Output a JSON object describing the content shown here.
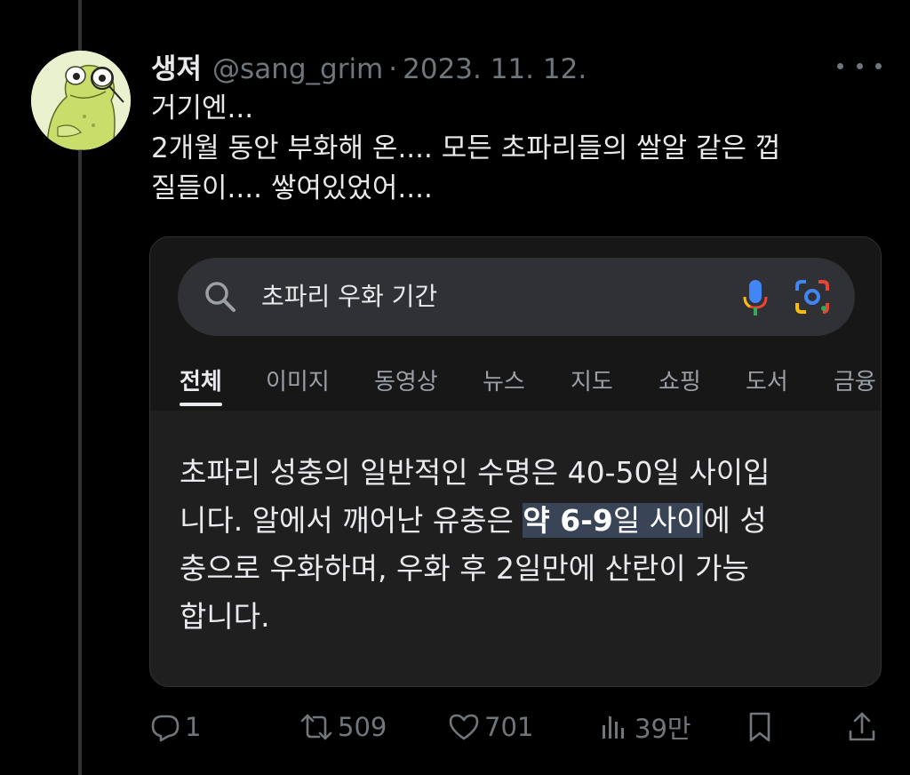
{
  "tweet": {
    "display_name": "생져",
    "handle": "@sang_grim",
    "separator": "·",
    "date": "2023. 11. 12.",
    "text_lines": [
      "거기엔...",
      "2개월 동안 부화해 온.... 모든 초파리들의 쌀알 같은 껍",
      "질들이.... 쌓여있었어...."
    ]
  },
  "screenshot": {
    "search_query": "초파리 우화 기간",
    "tabs": [
      "전체",
      "이미지",
      "동영상",
      "뉴스",
      "지도",
      "쇼핑",
      "도서",
      "금융"
    ],
    "active_tab": "전체",
    "answer": {
      "line1": "초파리 성충의 일반적인 수명은 40-50일 사이입",
      "line2_before": "니다. 알에서 깨어난 유충은 ",
      "line2_hl_bold": "약 6-9",
      "line2_hl_rest": "일 사이",
      "line2_after": "에 성",
      "line3": "충으로 우화하며, 우화 후 2일만에 산란이 가능",
      "line4": "합니다."
    }
  },
  "actions": {
    "replies": "1",
    "retweets": "509",
    "likes": "701",
    "views": "39만"
  },
  "icons": {
    "more": "more-icon",
    "search": "search-icon",
    "mic": "mic-icon",
    "lens": "lens-icon",
    "reply": "reply-icon",
    "retweet": "retweet-icon",
    "like": "heart-icon",
    "views": "views-icon",
    "bookmark": "bookmark-icon",
    "share": "share-icon"
  },
  "colors": {
    "background": "#000000",
    "text": "#e7e9ea",
    "secondary": "#71767b",
    "highlight": "#394457"
  }
}
